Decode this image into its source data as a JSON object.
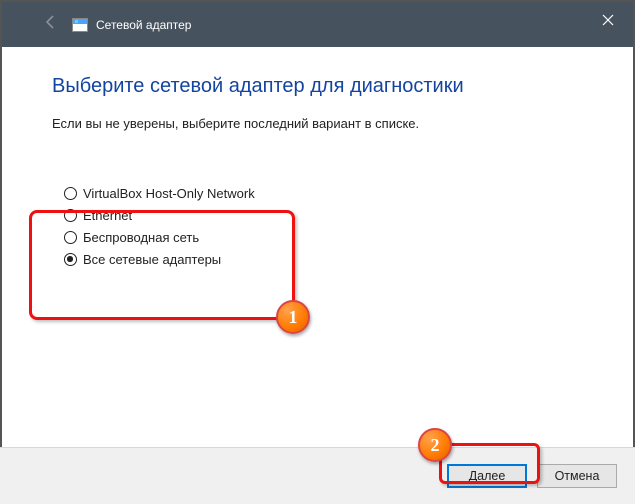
{
  "titlebar": {
    "title": "Сетевой адаптер"
  },
  "page": {
    "heading": "Выберите сетевой адаптер для диагностики",
    "subtext": "Если вы не уверены, выберите последний вариант в списке."
  },
  "radios": {
    "opt0": "VirtualBox Host-Only Network",
    "opt1": "Ethernet",
    "opt2": "Беспроводная сеть",
    "opt3": "Все сетевые адаптеры",
    "selected_index": 3
  },
  "buttons": {
    "next": "Далее",
    "cancel": "Отмена"
  },
  "annotations": {
    "badge1": "1",
    "badge2": "2"
  }
}
